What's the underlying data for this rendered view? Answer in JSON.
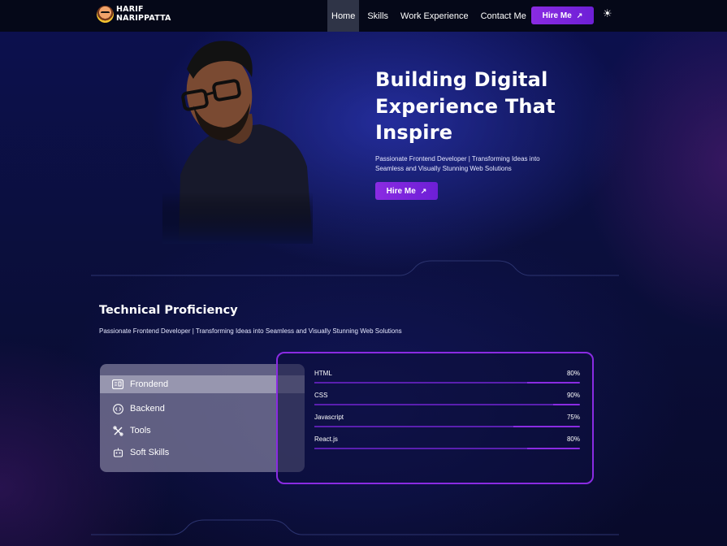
{
  "brand": {
    "name_line1": "HARIF",
    "name_line2": "NARIPPATTA"
  },
  "nav": {
    "items": [
      {
        "label": "Home",
        "active": true
      },
      {
        "label": "Skills",
        "active": false
      },
      {
        "label": "Work Experience",
        "active": false
      },
      {
        "label": "Contact Me",
        "active": false
      }
    ],
    "hire_label": "Hire Me",
    "theme_icon": "sun-icon"
  },
  "hero": {
    "title_line1": "Building Digital",
    "title_line2": "Experience That",
    "title_line3": "Inspire",
    "subtitle_line1": "Passionate Frontend Developer | Transforming Ideas into",
    "subtitle_line2": "Seamless and Visually Stunning Web Solutions",
    "hire_label": "Hire Me"
  },
  "skills": {
    "title": "Technical Proficiency",
    "subtitle": "Passionate Frontend Developer | Transforming Ideas into Seamless and Visually Stunning Web Solutions",
    "tabs": [
      {
        "label": "Frondend",
        "icon": "layout-icon",
        "active": true
      },
      {
        "label": "Backend",
        "icon": "code-circle-icon",
        "active": false
      },
      {
        "label": "Tools",
        "icon": "tools-icon",
        "active": false
      },
      {
        "label": "Soft Skills",
        "icon": "robot-icon",
        "active": false
      }
    ],
    "items": [
      {
        "name": "HTML",
        "percent_label": "80%",
        "percent": 80
      },
      {
        "name": "CSS",
        "percent_label": "90%",
        "percent": 90
      },
      {
        "name": "Javascript",
        "percent_label": "75%",
        "percent": 75
      },
      {
        "name": "React.js",
        "percent_label": "80%",
        "percent": 80
      }
    ]
  },
  "colors": {
    "accent": "#8a2be2",
    "nav_bg": "#050818",
    "background": "#0a0b2e"
  }
}
